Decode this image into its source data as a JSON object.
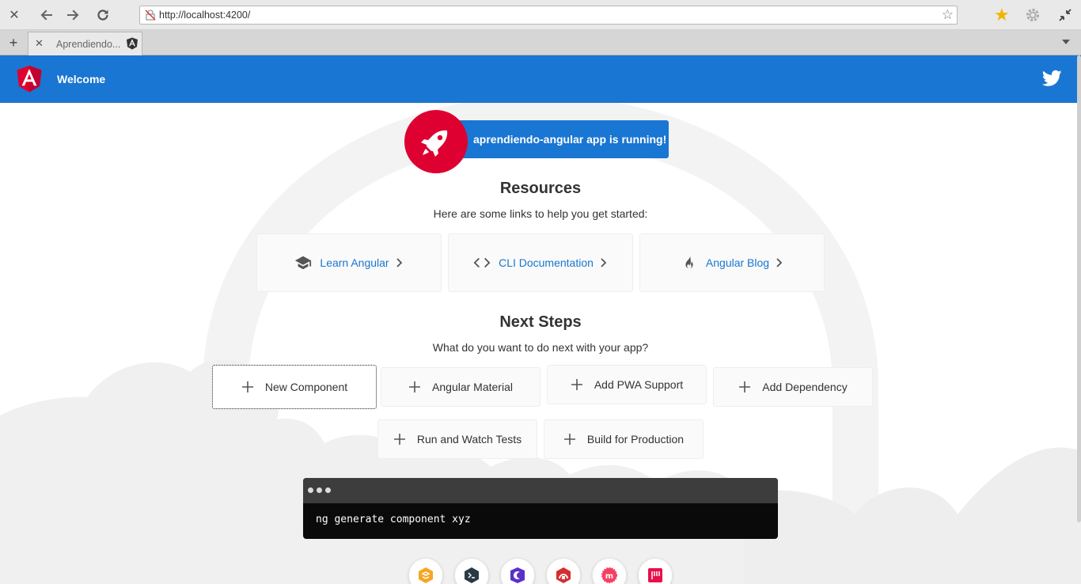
{
  "browser": {
    "url": "http://localhost:4200/",
    "tab_title": "Aprendiendo..."
  },
  "toolbar": {
    "title": "Welcome"
  },
  "highlight": {
    "text": "aprendiendo-angular app is running!"
  },
  "resources": {
    "heading": "Resources",
    "subtext": "Here are some links to help you get started:",
    "cards": [
      {
        "label": "Learn Angular",
        "icon": "school-icon"
      },
      {
        "label": "CLI Documentation",
        "icon": "code-icon"
      },
      {
        "label": "Angular Blog",
        "icon": "fire-icon"
      }
    ]
  },
  "next_steps": {
    "heading": "Next Steps",
    "subtext": "What do you want to do next with your app?",
    "buttons": [
      "New Component",
      "Angular Material",
      "Add PWA Support",
      "Add Dependency",
      "Run and Watch Tests",
      "Build for Production"
    ]
  },
  "terminal": {
    "command": "ng generate component xyz"
  },
  "colors": {
    "toolbar": "#1976d2",
    "angular_red": "#dd0031",
    "link": "#1976d2"
  }
}
